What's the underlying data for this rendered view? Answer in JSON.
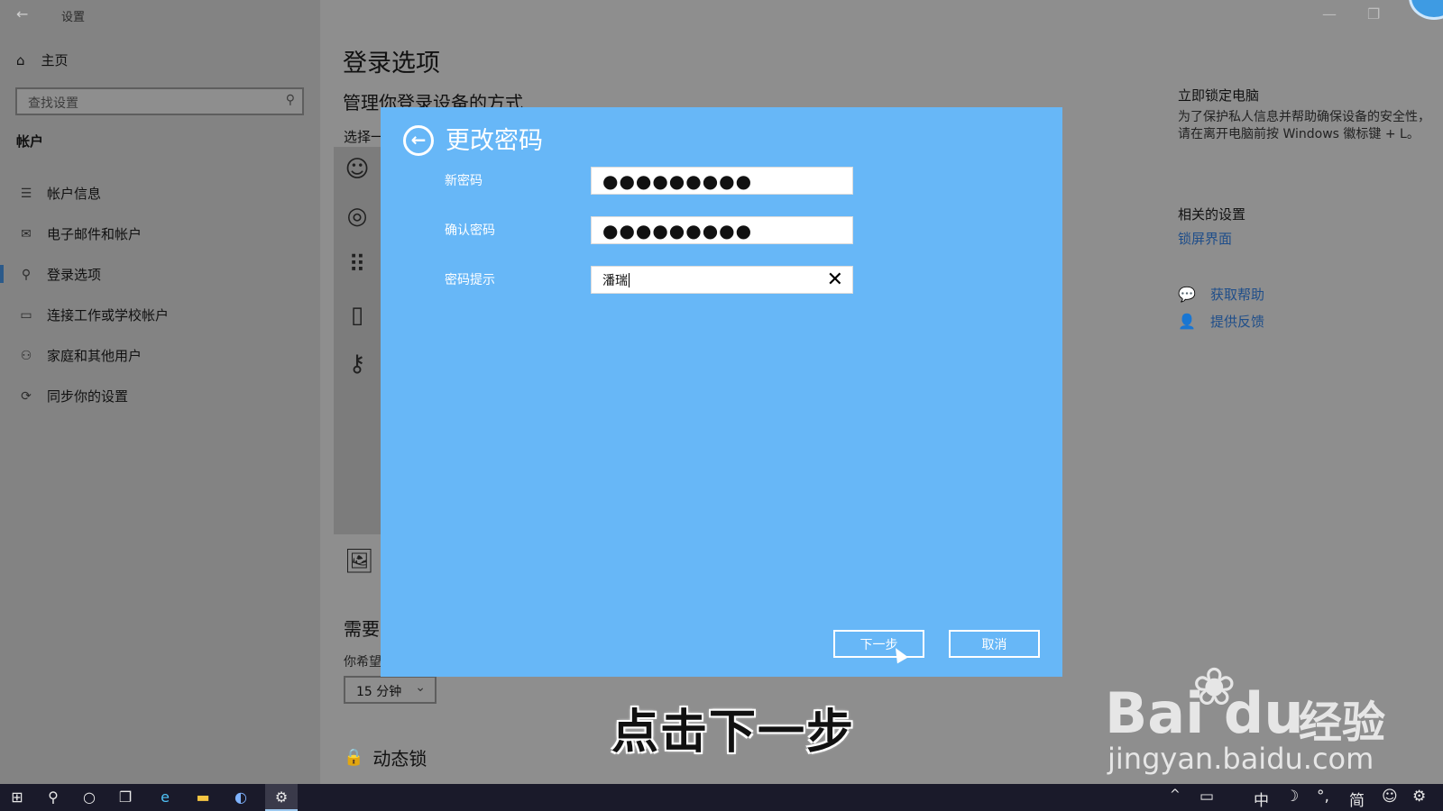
{
  "window": {
    "title": "设置",
    "back_glyph": "←",
    "minimize_glyph": "—",
    "restore_glyph": "❐"
  },
  "sidebar": {
    "home_label": "主页",
    "search_placeholder": "查找设置",
    "section_title": "帐户",
    "items": [
      {
        "label": "帐户信息",
        "icon": "account-info-icon",
        "glyph": "☰",
        "active": false
      },
      {
        "label": "电子邮件和帐户",
        "icon": "mail-icon",
        "glyph": "✉",
        "active": false
      },
      {
        "label": "登录选项",
        "icon": "key-icon",
        "glyph": "⚲",
        "active": true
      },
      {
        "label": "连接工作或学校帐户",
        "icon": "briefcase-icon",
        "glyph": "▭",
        "active": false
      },
      {
        "label": "家庭和其他用户",
        "icon": "person-icon",
        "glyph": "⚇",
        "active": false
      },
      {
        "label": "同步你的设置",
        "icon": "sync-icon",
        "glyph": "⟳",
        "active": false
      }
    ]
  },
  "main": {
    "title": "登录选项",
    "subtitle": "管理你登录设备的方式",
    "select_label": "选择一",
    "option_icons": [
      {
        "name": "face-icon",
        "glyph": "☺"
      },
      {
        "name": "fingerprint-icon",
        "glyph": "◎"
      },
      {
        "name": "pin-icon",
        "glyph": "⠿"
      },
      {
        "name": "security-key-icon",
        "glyph": "▯"
      },
      {
        "name": "password-key-icon",
        "glyph": "⚷"
      }
    ],
    "picture_icon_glyph": "🖼",
    "need_label": "需要",
    "hope_label": "你希望",
    "dropdown_value": "15 分钟",
    "dynamic_lock_label": "动态锁",
    "dynamic_lock_glyph": "🔒"
  },
  "right": {
    "lock_title": "立即锁定电脑",
    "lock_desc": "为了保护私人信息并帮助确保设备的安全性，请在离开电脑前按 Windows 徽标键 + L。",
    "related_title": "相关的设置",
    "lockscreen_link": "锁屏界面",
    "help_link": "获取帮助",
    "feedback_link": "提供反馈",
    "help_glyph": "💬",
    "feedback_glyph": "👤"
  },
  "dialog": {
    "back_glyph": "←",
    "title": "更改密码",
    "fields": {
      "new_password_label": "新密码",
      "new_password_value": "●●●●●●●●●",
      "confirm_password_label": "确认密码",
      "confirm_password_value": "●●●●●●●●●",
      "hint_label": "密码提示",
      "hint_value": "潘瑞"
    },
    "clear_glyph": "✕",
    "next_button": "下一步",
    "cancel_button": "取消"
  },
  "overlay": {
    "caption": "点击下一步",
    "watermark_brand": "Bai  du",
    "watermark_paw": "❀",
    "watermark_jingyan": "经验",
    "watermark_url": "jingyan.baidu.com"
  },
  "taskbar": {
    "start_glyph": "⊞",
    "search_glyph": "⚲",
    "cortana_glyph": "○",
    "taskview_glyph": "❐",
    "edge_glyph": "e",
    "explorer_glyph": "▬",
    "browser_glyph": "◐",
    "settings_glyph": "⚙",
    "tray": {
      "chevron": "^",
      "battery": "▭",
      "ime_lang": "中",
      "moon": "☽",
      "punct": "°,",
      "ime_mode": "简",
      "emoji": "☺",
      "gear": "⚙"
    }
  },
  "colors": {
    "dialog_bg": "#67b7f7",
    "overlay_gray": "#8e8e8e",
    "link": "#1f4e8a",
    "taskbar": "#1a1a2a"
  }
}
